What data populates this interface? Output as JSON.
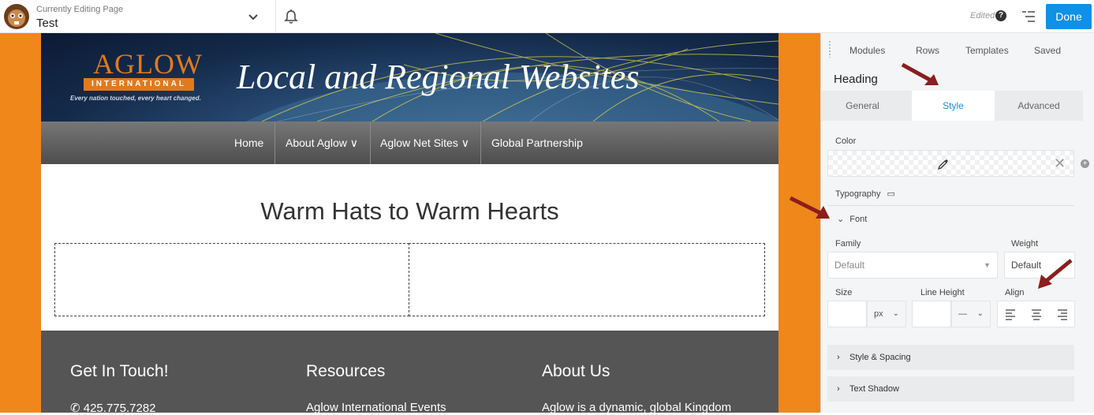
{
  "topbar": {
    "editing_label": "Currently Editing Page",
    "page_title": "Test",
    "edited_label": "Edited",
    "done_label": "Done"
  },
  "banner": {
    "logo_word": "AGLOW",
    "logo_band": "INTERNATIONAL",
    "logo_tagline": "Every nation touched, every heart changed.",
    "title": "Local and Regional Websites"
  },
  "nav": {
    "items": [
      {
        "label": "Home"
      },
      {
        "label": "About Aglow ∨"
      },
      {
        "label": "Aglow Net Sites ∨"
      },
      {
        "label": "Global Partnership"
      }
    ]
  },
  "content": {
    "heading": "Warm Hats to Warm Hearts"
  },
  "footer": {
    "col1_title": "Get In Touch!",
    "col1_text": "425.775.7282",
    "col2_title": "Resources",
    "col2_text": "Aglow International Events",
    "col3_title": "About Us",
    "col3_text": "Aglow is a dynamic, global Kingdom"
  },
  "panel": {
    "tabs": [
      "Modules",
      "Rows",
      "Templates",
      "Saved"
    ],
    "title": "Heading",
    "subtabs": [
      "General",
      "Style",
      "Advanced"
    ],
    "active_subtab": "Style",
    "color_label": "Color",
    "typography_label": "Typography",
    "font_label": "Font",
    "family_label": "Family",
    "family_value": "Default",
    "weight_label": "Weight",
    "weight_value": "Default",
    "size_label": "Size",
    "size_unit": "px",
    "line_height_label": "Line Height",
    "line_height_unit": "—",
    "align_label": "Align",
    "sections": [
      "Style & Spacing",
      "Text Shadow"
    ]
  },
  "colors": {
    "accent": "#0e91e6",
    "canvas_border": "#f0871a",
    "annotation_arrow": "#8b1e1e"
  }
}
